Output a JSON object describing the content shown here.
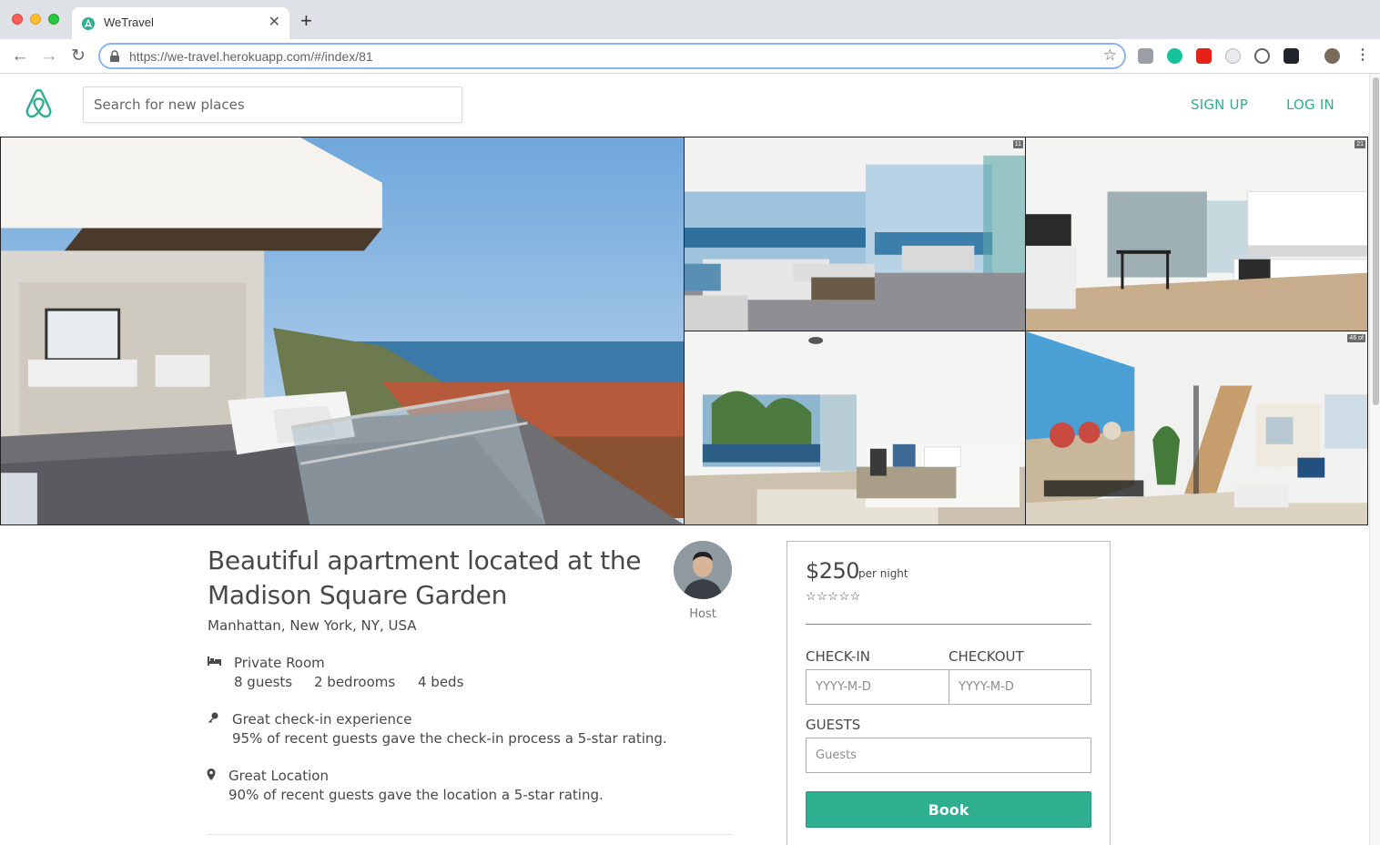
{
  "browser": {
    "tab_title": "WeTravel",
    "url_host": "https://we-travel.herokuapp.com",
    "url_path": "/#/index/81"
  },
  "header": {
    "search_placeholder": "Search for new places",
    "sign_up": "SIGN UP",
    "log_in": "LOG IN"
  },
  "listing": {
    "title": "Beautiful apartment located at the Madison Square Garden",
    "location": "Manhattan, New York, NY, USA",
    "host_label": "Host",
    "room_type": "Private Room",
    "guests": "8 guests",
    "bedrooms": "2 bedrooms",
    "beds": "4 beds",
    "checkin_title": "Great check-in experience",
    "checkin_text": "95% of recent guests gave the check-in process a 5-star rating.",
    "location_title": "Great Location",
    "location_text": "90% of recent guests gave the location a 5-star rating."
  },
  "gallery": {
    "photo_tags": [
      "11",
      "21",
      "46 of"
    ]
  },
  "booking": {
    "price": "$250",
    "per_night": "per night",
    "stars": "☆☆☆☆☆",
    "checkin_label": "CHECK-IN",
    "checkout_label": "CHECKOUT",
    "date_placeholder": "YYYY-M-D",
    "guests_label": "GUESTS",
    "guests_placeholder": "Guests",
    "book_label": "Book"
  },
  "colors": {
    "brand": "#2eaf8f",
    "text": "#484848"
  },
  "icons": [
    "airbnb-logo-icon",
    "lock-icon",
    "star-icon",
    "bed-icon",
    "key-icon",
    "pin-icon"
  ]
}
